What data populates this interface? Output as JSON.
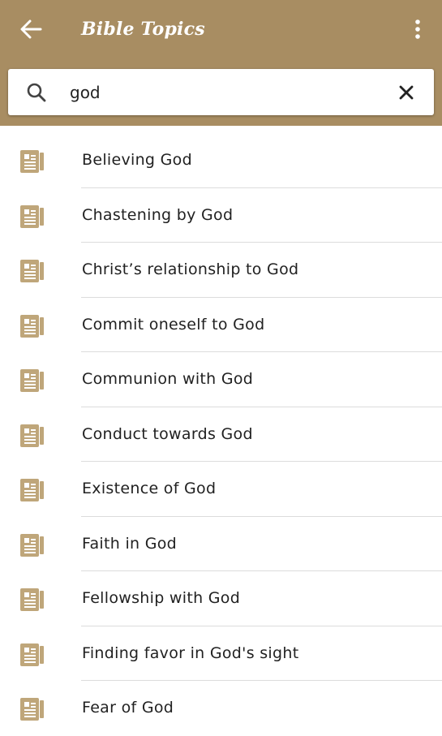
{
  "appbar": {
    "title": "Bible Topics",
    "back_icon": "arrow-left-icon",
    "more_icon": "more-vertical-icon",
    "color": "#a88d62"
  },
  "search": {
    "value": "god",
    "search_icon": "search-icon",
    "clear_icon": "close-icon"
  },
  "topics": [
    {
      "label": "Believing God",
      "icon": "book-icon"
    },
    {
      "label": "Chastening by God",
      "icon": "book-icon"
    },
    {
      "label": "Christ’s relationship to God",
      "icon": "book-icon"
    },
    {
      "label": "Commit oneself to God",
      "icon": "book-icon"
    },
    {
      "label": "Communion with God",
      "icon": "book-icon"
    },
    {
      "label": "Conduct towards God",
      "icon": "book-icon"
    },
    {
      "label": "Existence of God",
      "icon": "book-icon"
    },
    {
      "label": "Faith in God",
      "icon": "book-icon"
    },
    {
      "label": "Fellowship with God",
      "icon": "book-icon"
    },
    {
      "label": "Finding favor in God's sight",
      "icon": "book-icon"
    },
    {
      "label": "Fear of God",
      "icon": "book-icon"
    }
  ],
  "colors": {
    "icon": "#bfa67a",
    "divider": "#dcdcdc",
    "text": "#212121"
  }
}
